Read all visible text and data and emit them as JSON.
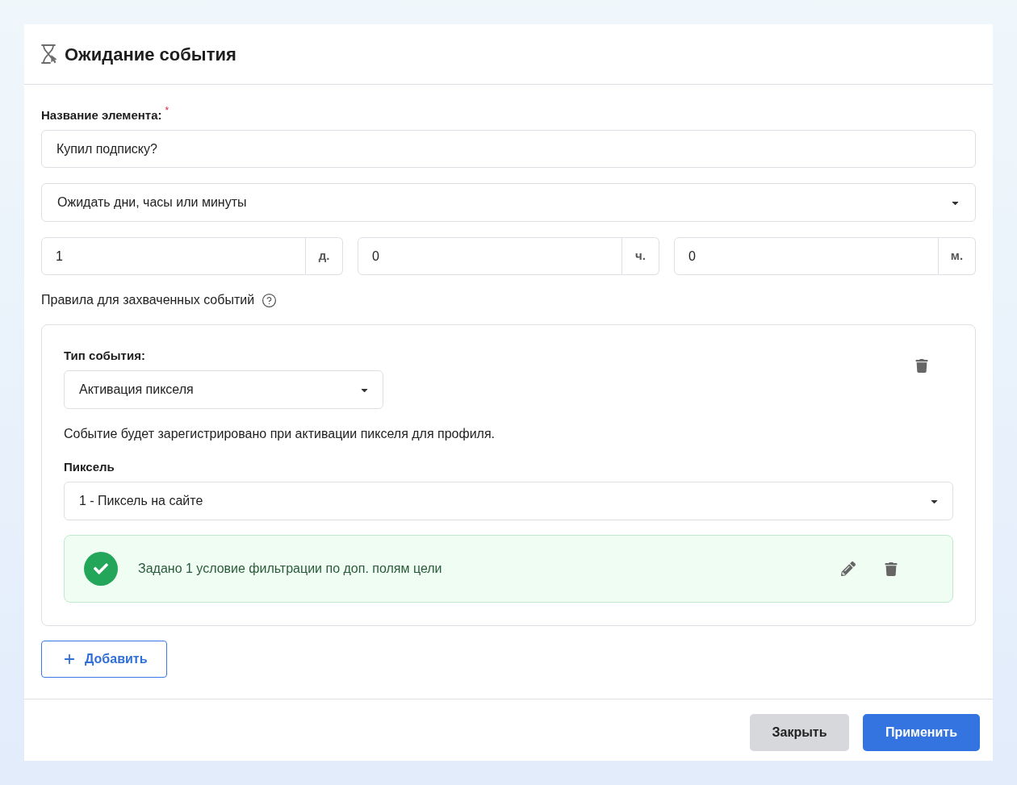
{
  "dialog": {
    "title": "Ожидание события"
  },
  "name_field": {
    "label": "Название элемента:",
    "required_mark": "*",
    "value": "Купил подписку?"
  },
  "wait_mode": {
    "value": "Ожидать дни, часы или минуты"
  },
  "duration": [
    {
      "value": "1",
      "unit": "д."
    },
    {
      "value": "0",
      "unit": "ч."
    },
    {
      "value": "0",
      "unit": "м."
    }
  ],
  "rules": {
    "label": "Правила для захваченных событий",
    "items": [
      {
        "event_type_label": "Тип события:",
        "event_type": "Активация пикселя",
        "description": "Событие будет зарегистрировано при активации пикселя для профиля.",
        "pixel_label": "Пиксель",
        "pixel": "1 - Пиксель на сайте",
        "filter_text": "Задано 1 условие фильтрации по доп. полям цели"
      }
    ]
  },
  "add_button": {
    "label": "Добавить"
  },
  "footer_buttons": [
    {
      "label": "Закрыть",
      "kind": "secondary"
    },
    {
      "label": "Применить",
      "kind": "primary"
    }
  ]
}
